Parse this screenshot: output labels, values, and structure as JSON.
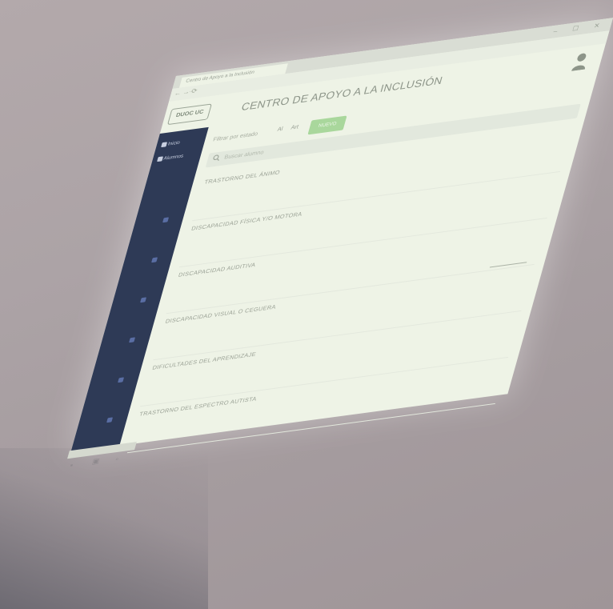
{
  "browser": {
    "tab_title": "Centro de Apoyo a la Inclusión",
    "url": "...",
    "window_controls": "– ☐ ✕",
    "nav_arrows": "← → ⟳"
  },
  "header": {
    "logo_text": "DUOC UC",
    "title": "CENTRO DE APOYO A LA INCLUSIÓN",
    "user_icon": "user-icon"
  },
  "toolbar": {
    "filter_label": "Filtrar por estado",
    "chip1": "Al",
    "chip2": "Art",
    "new_button": "NUEVO"
  },
  "search": {
    "placeholder": "Buscar alumno"
  },
  "list": {
    "items": [
      "TRASTORNO DEL ÁNIMO",
      "DISCAPACIDAD FÍSICA Y/O MOTORA",
      "DISCAPACIDAD AUDITIVA",
      "DISCAPACIDAD VISUAL O CEGUERA",
      "DIFICULTADES DEL APRENDIZAJE",
      "TRASTORNO DEL ESPECTRO AUTISTA"
    ]
  },
  "sidebar": {
    "items": [
      "Inicio",
      "Alumnos"
    ]
  },
  "colors": {
    "wall": "#aca3a6",
    "screen": "#eef3e6",
    "sidebar": "#2e3a56",
    "accent_green": "#a9d79c"
  }
}
